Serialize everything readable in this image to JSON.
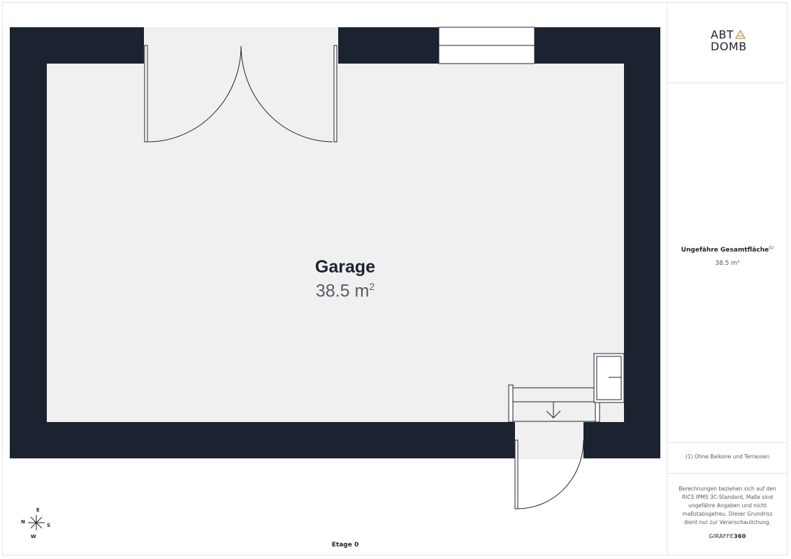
{
  "logo": {
    "line1": "ABT",
    "line2": "DOMB",
    "accent_color": "#c9a36a"
  },
  "room": {
    "name": "Garage",
    "area": "38.5 m",
    "area_superscript": "2"
  },
  "floor_label": "Etage 0",
  "compass": {
    "north": "N",
    "east": "E",
    "south": "S",
    "west": "W"
  },
  "summary": {
    "title": "Ungefähre Gesamtfläche",
    "title_note": "(1)",
    "value": "38.5 m²"
  },
  "footnote": "(1) Ohne Balkone und Terrassen",
  "disclaimer": "Berechnungen beziehen sich auf den RICS IPMS 3C-Standard, Maße sind ungefähre Angaben und nicht maßstabsgetreu. Dieser Grundriss dient nur zur Veranschaulichung.",
  "brand": {
    "prefix": "GIRAFFE",
    "suffix": "360"
  },
  "colors": {
    "wall": "#1b2230",
    "floor": "#f0f0f0",
    "text_dark": "#1b2230",
    "text_muted": "#555c66"
  }
}
